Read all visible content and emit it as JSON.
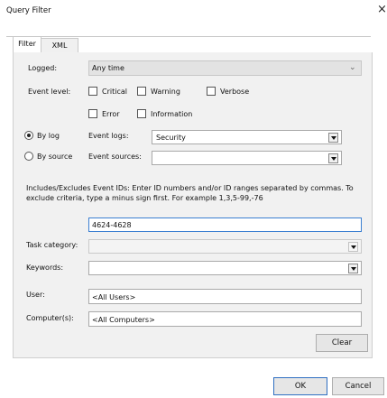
{
  "window": {
    "title": "Query Filter",
    "close_glyph": "×"
  },
  "tabs": [
    {
      "label": "Filter"
    },
    {
      "label": "XML"
    }
  ],
  "filter": {
    "logged": {
      "label": "Logged:",
      "value": "Any time"
    },
    "event_level": {
      "label": "Event level:",
      "options": [
        {
          "label": "Critical",
          "checked": false
        },
        {
          "label": "Warning",
          "checked": false
        },
        {
          "label": "Verbose",
          "checked": false
        },
        {
          "label": "Error",
          "checked": false
        },
        {
          "label": "Information",
          "checked": false
        }
      ]
    },
    "by_log": {
      "label": "By log",
      "selected": true
    },
    "by_source": {
      "label": "By source",
      "selected": false
    },
    "event_logs": {
      "label": "Event logs:",
      "value": "Security"
    },
    "event_sources": {
      "label": "Event sources:",
      "value": ""
    },
    "event_ids": {
      "description": "Includes/Excludes Event IDs: Enter ID numbers and/or ID ranges separated by commas. To exclude criteria, type a minus sign first. For example 1,3,5-99,-76",
      "value": "4624-4628"
    },
    "task_category": {
      "label": "Task category:",
      "value": ""
    },
    "keywords": {
      "label": "Keywords:",
      "value": ""
    },
    "user": {
      "label": "User:",
      "value": "<All Users>"
    },
    "computers": {
      "label": "Computer(s):",
      "value": "<All Computers>"
    },
    "clear_label": "Clear"
  },
  "footer": {
    "ok_label": "OK",
    "cancel_label": "Cancel"
  }
}
